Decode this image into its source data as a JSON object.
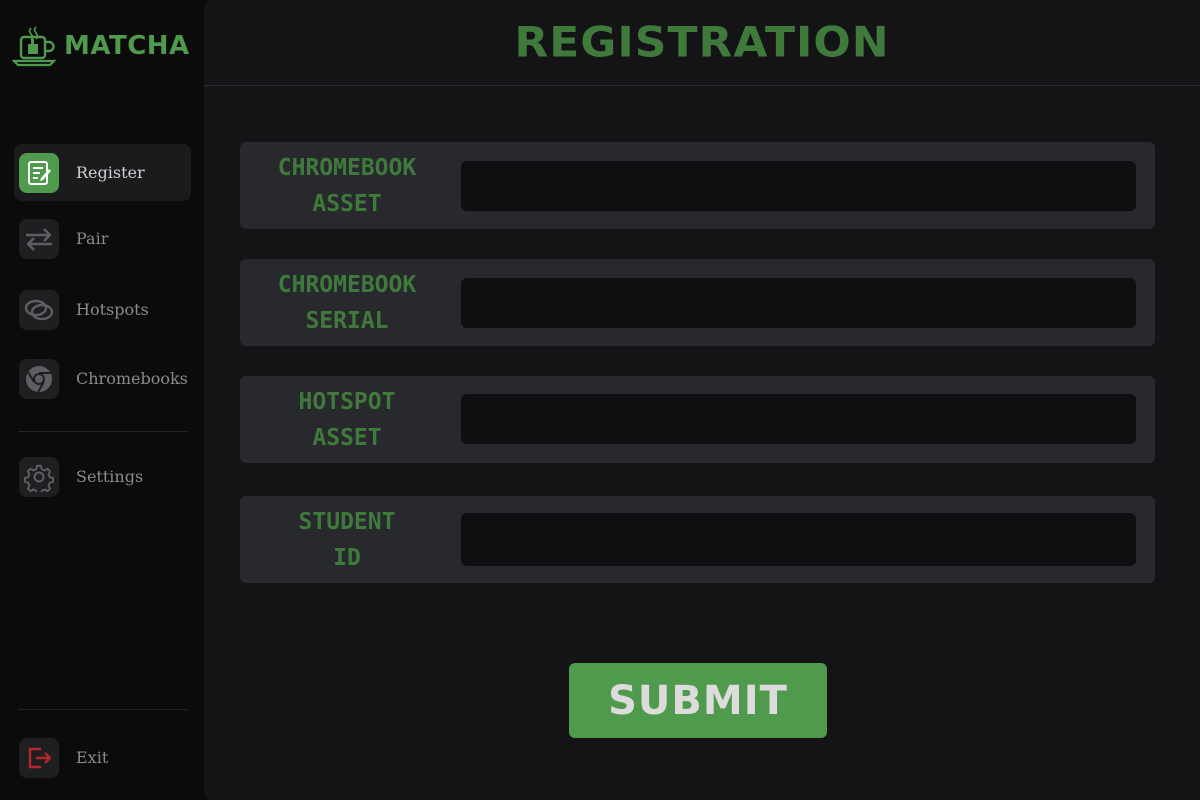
{
  "app": {
    "name": "MATCHA",
    "logo_icon": "matcha-cup-icon",
    "accent_color": "#4f9a4c"
  },
  "sidebar": {
    "items": [
      {
        "label": "Register",
        "icon": "clipboard-edit-icon",
        "active": true
      },
      {
        "label": "Pair",
        "icon": "swap-arrows-icon",
        "active": false
      },
      {
        "label": "Hotspots",
        "icon": "hotspot-rings-icon",
        "active": false
      },
      {
        "label": "Chromebooks",
        "icon": "chrome-icon",
        "active": false
      },
      {
        "label": "Settings",
        "icon": "gear-icon",
        "active": false
      },
      {
        "label": "Exit",
        "icon": "exit-icon",
        "active": false
      }
    ]
  },
  "main": {
    "title": "REGISTRATION",
    "fields": [
      {
        "label": "CHROMEBOOK\nASSET",
        "value": ""
      },
      {
        "label": "CHROMEBOOK\nSERIAL",
        "value": ""
      },
      {
        "label": "HOTSPOT\nASSET",
        "value": ""
      },
      {
        "label": "STUDENT\nID",
        "value": ""
      }
    ],
    "submit_label": "SUBMIT"
  }
}
